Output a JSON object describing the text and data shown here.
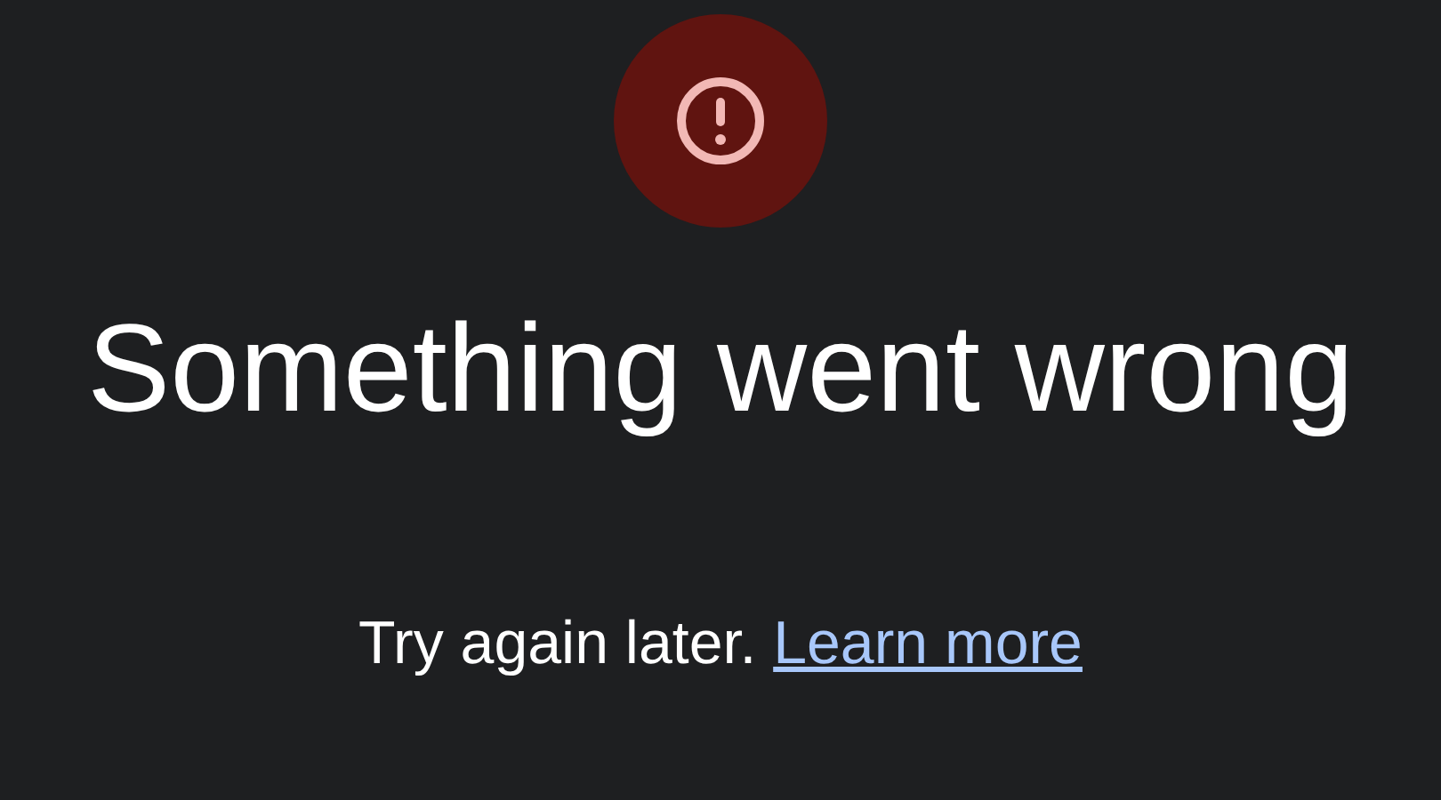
{
  "title": "Something went wrong",
  "message": "Try again later.",
  "link": "Learn more"
}
